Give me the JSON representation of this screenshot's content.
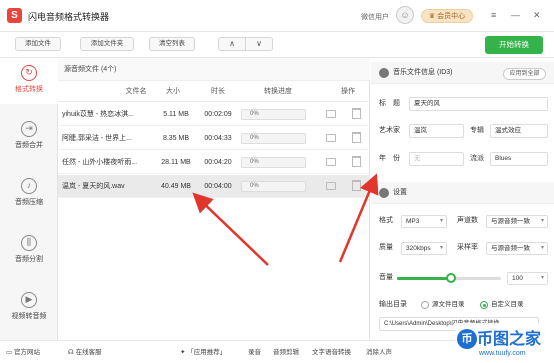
{
  "app": {
    "title": "闪电音频格式转换器",
    "logo_letter": "S",
    "user": "微信用户",
    "member": "会员中心",
    "win_menu": "≡",
    "win_min": "—",
    "win_close": "✕"
  },
  "toolbar": {
    "add_file": "添加文件",
    "add_folder": "添加文件夹",
    "clear_list": "清空列表",
    "move_up": "∧",
    "move_down": "∨",
    "start": "开始转换"
  },
  "sidebar": [
    {
      "label": "格式转换",
      "icon": "↻"
    },
    {
      "label": "音频合并",
      "icon": "⇥"
    },
    {
      "label": "音频压缩",
      "icon": "♪"
    },
    {
      "label": "音频分割",
      "icon": "⫼"
    },
    {
      "label": "视频转音频",
      "icon": "▶"
    }
  ],
  "filelist": {
    "header": "源音频文件 (4个)",
    "columns": {
      "name": "文件名",
      "size": "大小",
      "duration": "时长",
      "progress": "转换进度",
      "action": "操作"
    },
    "rows": [
      {
        "name": "yihuik苡慧 - 热恋冰淇...",
        "size": "5.11 MB",
        "duration": "00:02:09",
        "progress": "0%"
      },
      {
        "name": "阿睫,郭采洁 - 世界上...",
        "size": "8.35 MB",
        "duration": "00:04:33",
        "progress": "0%"
      },
      {
        "name": "任然 - 山外小楼夜听雨...",
        "size": "28.11 MB",
        "duration": "00:04:20",
        "progress": "0%"
      },
      {
        "name": "温岚 - 夏天的风.wav",
        "size": "40.49 MB",
        "duration": "00:04:00",
        "progress": "0%"
      }
    ]
  },
  "info": {
    "header": "音乐文件信息 (ID3)",
    "apply_all": "应用到全部",
    "title_label": "标　题",
    "title_value": "夏天的风",
    "artist_label": "艺术家",
    "artist_value": "温岚",
    "album_label": "专辑",
    "album_value": "温式效应",
    "year_label": "年　份",
    "year_placeholder": "无",
    "genre_label": "流派",
    "genre_value": "Blues"
  },
  "settings": {
    "header": "设置",
    "format_label": "格式",
    "format_value": "MP3",
    "channel_label": "声道数",
    "channel_value": "与源音频一致",
    "quality_label": "质量",
    "quality_value": "320kbps",
    "samplerate_label": "采样率",
    "samplerate_value": "与源音频一致",
    "volume_label": "音量",
    "volume_value": "100",
    "volume_fraction": 0.52,
    "output_label": "输出目录",
    "opt_source": "源文件目录",
    "opt_custom": "自定义目录",
    "output_path": "C:\\Users\\Admin\\Desktop\\闪电音频格式转换"
  },
  "footer": {
    "website": "官方网站",
    "support": "在线客服",
    "recommend": "「应用推荐」",
    "items": [
      "录音",
      "音频剪辑",
      "文字语音转换",
      "消除人声"
    ]
  },
  "watermark": {
    "brand": "币图之家",
    "url": "www.tuufy.com",
    "logo": "币"
  },
  "colors": {
    "accent": "#e8453c",
    "green": "#34b34a"
  }
}
